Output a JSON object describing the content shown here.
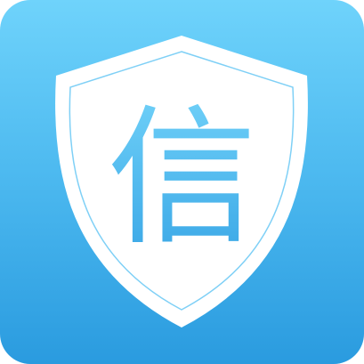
{
  "icon": {
    "name": "shield-icon",
    "glyph": "信",
    "colors": {
      "background_top": "#6fd3fb",
      "background_bottom": "#2a9bdf",
      "shield_fill": "#ffffff",
      "inner_outline": "#7fd0f6",
      "glyph_top": "#6fd0f8",
      "glyph_bottom": "#3aa7e6"
    }
  }
}
